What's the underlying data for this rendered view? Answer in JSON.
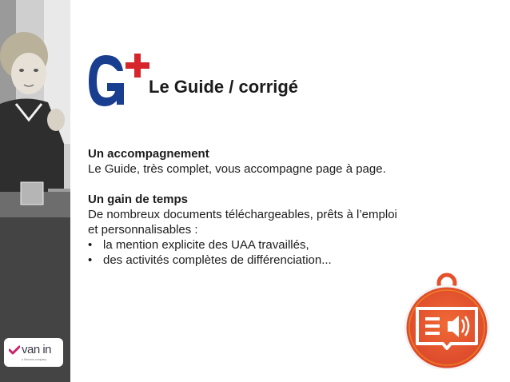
{
  "title": "Le Guide / corrigé",
  "brand_mark": "G+",
  "logo": {
    "name": "van in",
    "tagline": "a Sanoma company"
  },
  "sections": [
    {
      "heading": "Un accompagnement",
      "lines": [
        "Le Guide, très complet, vous accompagne page à page."
      ]
    },
    {
      "heading": "Un gain de temps",
      "lines": [
        "De nombreux documents téléchargeables, prêts à l’emploi",
        "et personnalisables :"
      ],
      "bullets": [
        "la mention explicite des UAA travaillés,",
        "des activités complètes de différenciation..."
      ]
    }
  ],
  "bullet_symbol": "•",
  "colors": {
    "brand_blue": "#1a3e8f",
    "accent_red": "#d6262b",
    "badge_orange": "#e6502d",
    "badge_light": "#f7a21b",
    "left_band": "#3a3a3a"
  },
  "icons": {
    "badge": "guide-audio-book-icon",
    "logo_check": "checkmark-icon"
  }
}
